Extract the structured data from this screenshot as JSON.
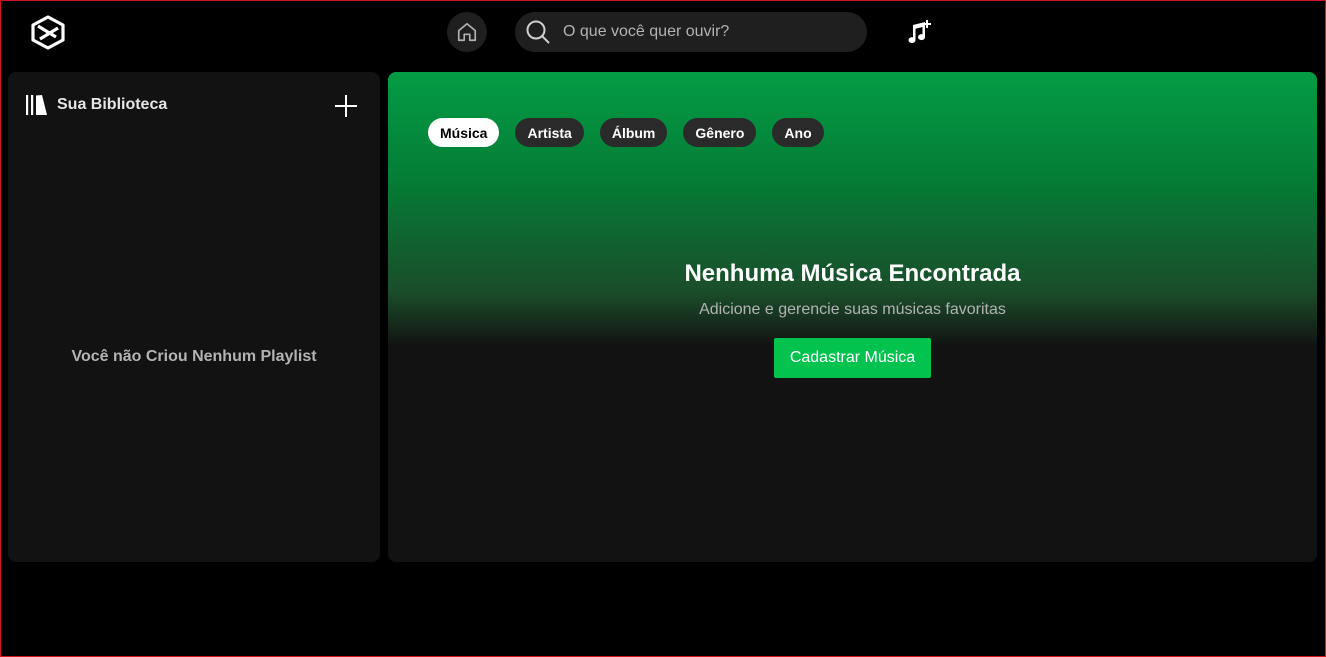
{
  "header": {
    "search_placeholder": "O que você quer ouvir?",
    "icons": [
      "app-logo-icon",
      "home-icon",
      "search-icon",
      "add-music-icon"
    ]
  },
  "sidebar": {
    "title": "Sua Biblioteca",
    "empty_message": "Você não Criou Nenhum Playlist"
  },
  "main": {
    "filters": [
      {
        "label": "Música",
        "active": true
      },
      {
        "label": "Artista",
        "active": false
      },
      {
        "label": "Álbum",
        "active": false
      },
      {
        "label": "Gênero",
        "active": false
      },
      {
        "label": "Ano",
        "active": false
      }
    ],
    "empty_title": "Nenhuma Música Encontrada",
    "empty_subtitle": "Adicione e gerencie suas músicas favoritas",
    "cta_label": "Cadastrar Música"
  },
  "colors": {
    "accent_green": "#03c34f",
    "gradient_top": "#049c45",
    "panel_bg": "#121212",
    "border": "#d0161c"
  }
}
